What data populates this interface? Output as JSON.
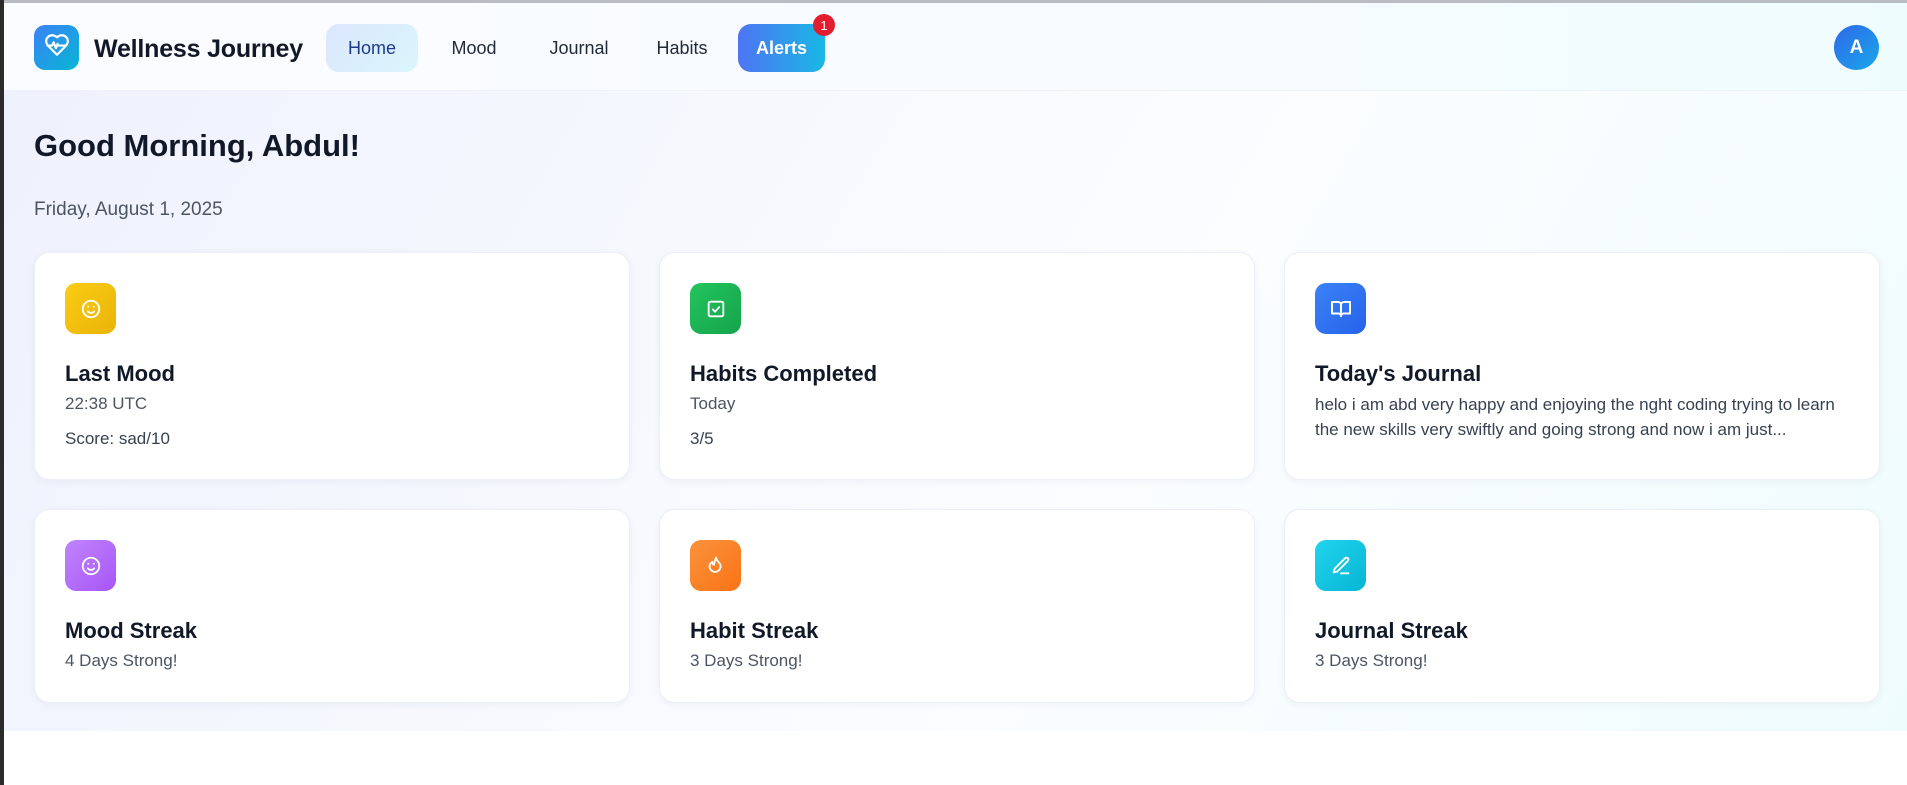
{
  "app": {
    "brand": "Wellness Journey",
    "logo_icon": "heart-pulse-icon"
  },
  "nav": {
    "items": [
      {
        "label": "Home",
        "active": true
      },
      {
        "label": "Mood"
      },
      {
        "label": "Journal"
      },
      {
        "label": "Habits"
      },
      {
        "label": "Alerts",
        "badge": "1"
      }
    ]
  },
  "user": {
    "initial": "A"
  },
  "page": {
    "greeting": "Good Morning, Abdul!",
    "date": "Friday, August 1, 2025"
  },
  "cards": [
    {
      "icon": "smile-icon",
      "color": "#facc15",
      "title": "Last Mood",
      "subtitle": "22:38 UTC",
      "meta": "Score: sad/10"
    },
    {
      "icon": "check-square-icon",
      "color": "#22c55e",
      "title": "Habits Completed",
      "subtitle": "Today",
      "meta": "3/5"
    },
    {
      "icon": "book-open-icon",
      "color": "#3b82f6",
      "title": "Today's Journal",
      "excerpt": "helo i am abd very happy and enjoying the nght coding trying to learn the new skills very swiftly and going strong and now i am just..."
    },
    {
      "icon": "smile-icon",
      "color": "#a855f7",
      "title": "Mood Streak",
      "subtitle": "4 Days Strong!"
    },
    {
      "icon": "flame-icon",
      "color": "#f97316",
      "title": "Habit Streak",
      "subtitle": "3 Days Strong!"
    },
    {
      "icon": "pencil-line-icon",
      "color": "#06b6d4",
      "title": "Journal Streak",
      "subtitle": "3 Days Strong!"
    }
  ]
}
